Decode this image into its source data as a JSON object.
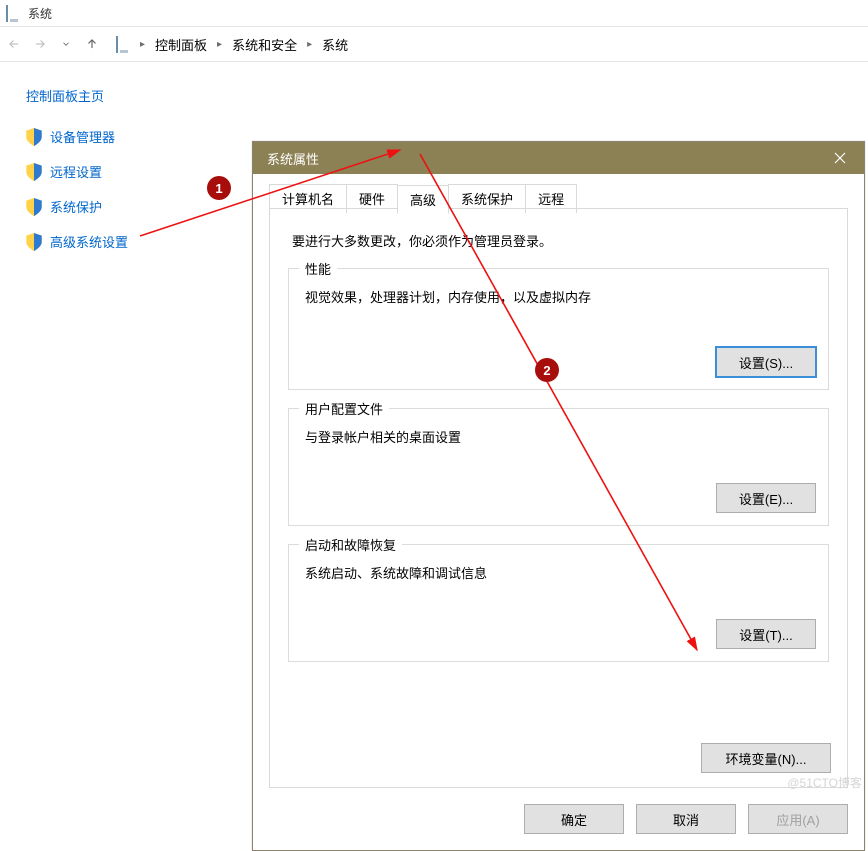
{
  "window": {
    "title": "系统"
  },
  "breadcrumb": {
    "items": [
      "控制面板",
      "系统和安全",
      "系统"
    ]
  },
  "sidebar": {
    "home": "控制面板主页",
    "links": [
      "设备管理器",
      "远程设置",
      "系统保护",
      "高级系统设置"
    ]
  },
  "dialog": {
    "title": "系统属性",
    "tabs": [
      "计算机名",
      "硬件",
      "高级",
      "系统保护",
      "远程"
    ],
    "active_tab_index": 2,
    "intro": "要进行大多数更改，你必须作为管理员登录。",
    "groups": {
      "performance": {
        "title": "性能",
        "desc": "视觉效果，处理器计划，内存使用，以及虚拟内存",
        "button": "设置(S)..."
      },
      "user_profiles": {
        "title": "用户配置文件",
        "desc": "与登录帐户相关的桌面设置",
        "button": "设置(E)..."
      },
      "startup": {
        "title": "启动和故障恢复",
        "desc": "系统启动、系统故障和调试信息",
        "button": "设置(T)..."
      }
    },
    "env_button": "环境变量(N)...",
    "footer": {
      "ok": "确定",
      "cancel": "取消",
      "apply": "应用(A)"
    }
  },
  "annotations": {
    "marker1": "1",
    "marker2": "2"
  },
  "watermark": "@51CTO博客"
}
